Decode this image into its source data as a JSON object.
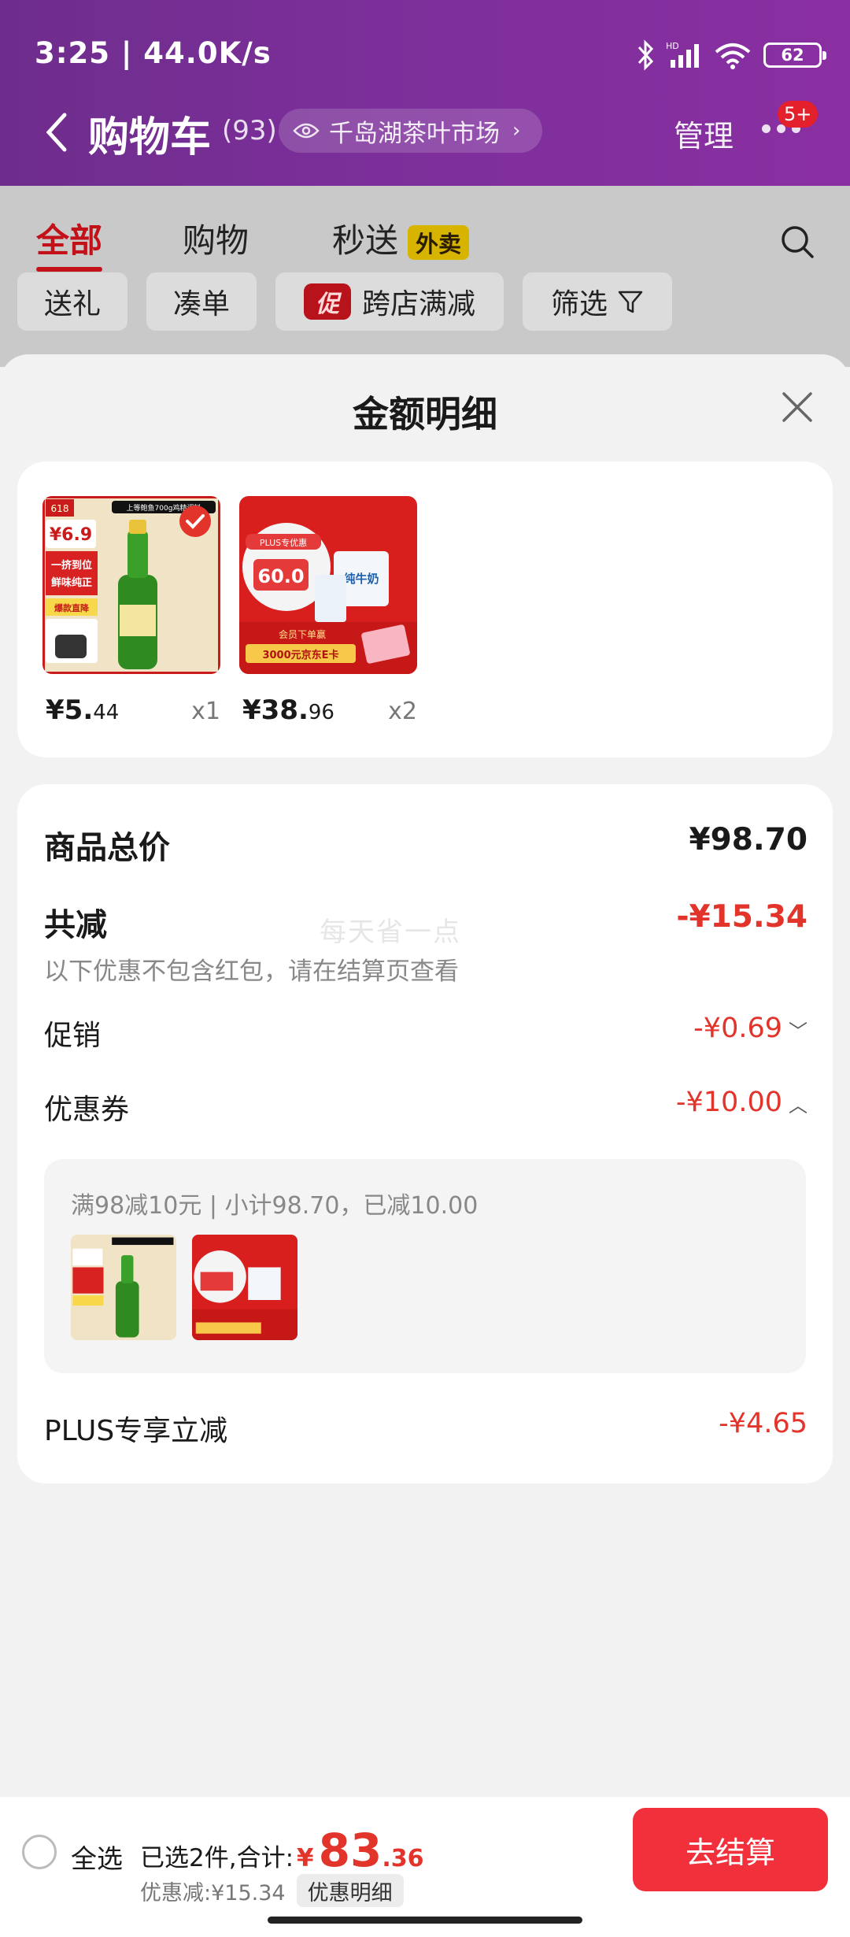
{
  "status_bar": {
    "time": "3:25 | 44.0K/s",
    "battery": "62"
  },
  "nav": {
    "title": "购物车",
    "count": "(93)",
    "store_pill": "千岛湖茶叶市场",
    "manage": "管理",
    "badge": "5+"
  },
  "cart_tabs": [
    {
      "label": "全部",
      "active": true
    },
    {
      "label": "购物",
      "active": false
    },
    {
      "label": "秒送",
      "active": false
    }
  ],
  "takeout_tag": "外卖",
  "filter_chips": [
    {
      "label": "送礼"
    },
    {
      "label": "凑单"
    },
    {
      "label": "跨店满减",
      "icon_label": "促"
    },
    {
      "label": "筛选"
    }
  ],
  "sheet": {
    "title": "金额明细",
    "products": [
      {
        "price_int": "¥5.",
        "price_dec": "44",
        "qty": "x1",
        "img": {
          "top_banner": "上等鲍鱼700g鸡精调料",
          "tag": "618",
          "price": "¥6.9",
          "line1": "一挤到位",
          "line2": "鲜味纯正",
          "line3": "爆款直降"
        }
      },
      {
        "price_int": "¥38.",
        "price_dec": "96",
        "qty": "x2",
        "img": {
          "tag": "PLUS专优惠",
          "price": "60.0",
          "milk": "纯牛奶",
          "promo": "3000元京东E卡",
          "promo_pre": "会员下单赢"
        }
      }
    ],
    "total_label": "商品总价",
    "total_value": "¥98.70",
    "reduce_label": "共减",
    "reduce_value": "-¥15.34",
    "reduce_note": "以下优惠不包含红包，请在结算页查看",
    "promo_label": "促销",
    "promo_value": "-¥0.69",
    "coupon_label": "优惠券",
    "coupon_value": "-¥10.00",
    "coupon_detail": "满98减10元 | 小计98.70，已减10.00",
    "plus_label": "PLUS专享立减",
    "plus_value": "-¥4.65",
    "watermark": "每天省一点"
  },
  "bottom": {
    "select_all": "全选",
    "selected_text": "已选2件,合计:",
    "yen": "¥",
    "total_int": "83",
    "total_dec": ".36",
    "discount_text": "优惠减:¥15.34",
    "detail_button": "优惠明细",
    "checkout_button": "去结算"
  },
  "colors": {
    "header": "#7c2f9a",
    "accent_red": "#e3342b",
    "checkout": "#f2303c"
  }
}
